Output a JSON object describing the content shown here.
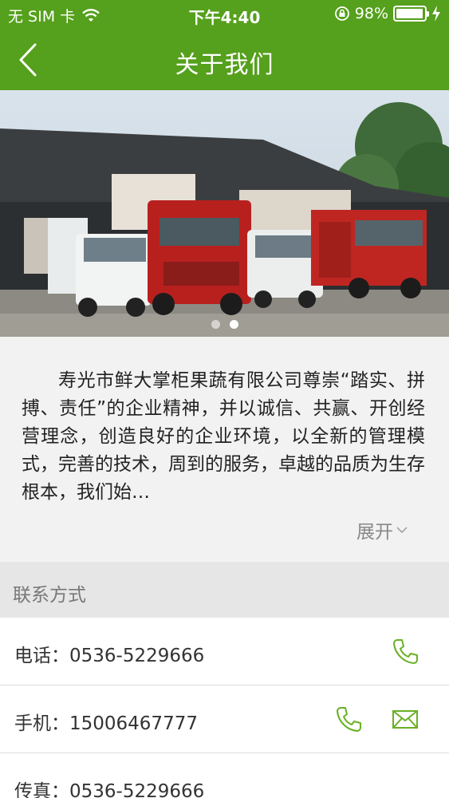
{
  "status_bar": {
    "carrier": "无 SIM 卡",
    "time": "下午4:40",
    "battery": "98%",
    "battery_level": 0.98
  },
  "navbar": {
    "title": "关于我们",
    "back_icon": "chevron-left-icon"
  },
  "banner": {
    "slides": 2,
    "active_slide": 2
  },
  "intro": {
    "text": "寿光市鲜大掌柜果蔬有限公司尊崇“踏实、拼搏、责任”的企业精神，并以诚信、共赢、开创经营理念，创造良好的企业环境，以全新的管理模式，完善的技术，周到的服务，卓越的品质为生存根本，我们始…",
    "expand_label": "展开"
  },
  "contact": {
    "section_title": "联系方式",
    "rows": [
      {
        "label": "电话：0536-5229666",
        "icons": [
          "phone-icon"
        ]
      },
      {
        "label": "手机：15006467777",
        "icons": [
          "phone-icon",
          "mail-icon"
        ]
      },
      {
        "label": "传真：0536-5229666",
        "icons": []
      }
    ]
  },
  "colors": {
    "brand": "#55a01c",
    "icon_green": "#6ab025"
  }
}
